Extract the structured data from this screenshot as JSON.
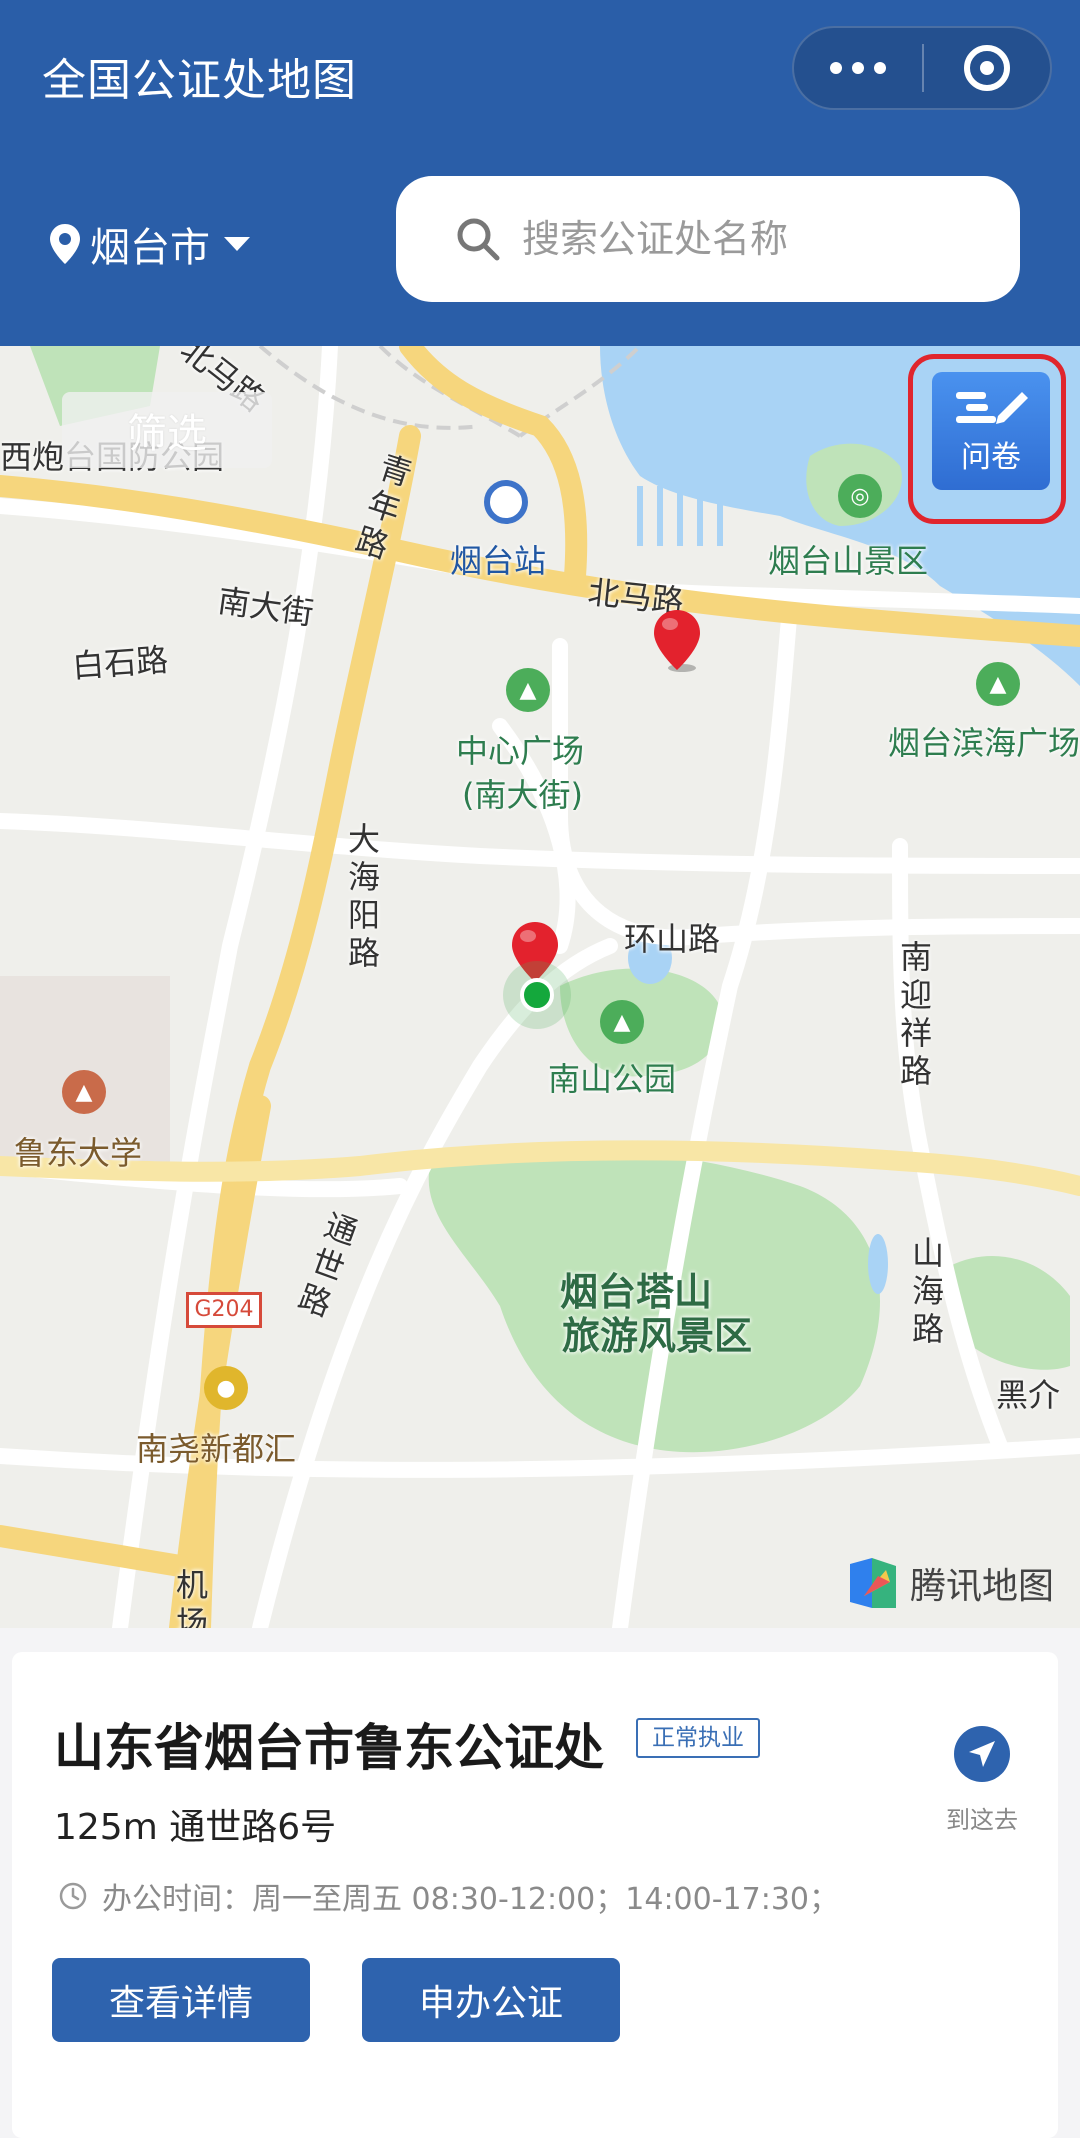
{
  "header": {
    "title": "全国公证处地图",
    "city": "烟台市",
    "search_placeholder": "搜索公证处名称"
  },
  "map": {
    "filter_label": "筛选",
    "survey_label": "问卷",
    "brand": "腾讯地图",
    "labels": {
      "xipaotai": "西炮台国防公园",
      "beimalu_top": "北马路",
      "qingnianlu": "青年路",
      "yantai_station": "烟台站",
      "yantaishan": "烟台山景区",
      "nandajie": "南大街",
      "beimalu": "北马路",
      "baishilu": "白石路",
      "zhongxin_1": "中心广场",
      "zhongxin_2": "(南大街)",
      "binhai": "烟台滨海广场",
      "dahaiyang": "大海阳路",
      "huanshanlu": "环山路",
      "nanyingxiang": "南迎祥路",
      "nanshan": "南山公园",
      "ludong": "鲁东大学",
      "tongshilu": "通世路",
      "tashan_1": "烟台塔山",
      "tashan_2": "旅游风景区",
      "shanhai": "山海路",
      "g204": "G204",
      "heijie": "黑介",
      "nanyao": "南尧新都汇",
      "jichang": "机场"
    }
  },
  "card": {
    "name": "山东省烟台市鲁东公证处",
    "status": "正常执业",
    "distance_address": "125m 通世路6号",
    "hours": "办公时间：周一至周五 08:30-12:00；14:00-17:30；",
    "navigate_label": "到这去",
    "detail_button": "查看详情",
    "apply_button": "申办公证"
  },
  "colors": {
    "brand_blue": "#2a5ea8",
    "button_blue": "#2e63ae",
    "highlight_red": "#e0252d",
    "park_green": "#bfe3b9",
    "water_blue": "#a9d3f5",
    "road_yellow": "#f6d67d"
  }
}
